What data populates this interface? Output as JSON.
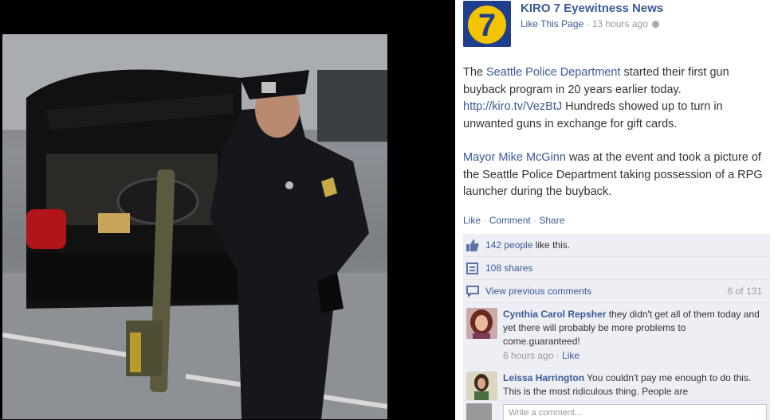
{
  "page": {
    "name": "KIRO 7 Eyewitness News",
    "like_page": "Like This Page",
    "separator": " · ",
    "time": "13 hours ago",
    "logo_numeral": "7"
  },
  "post": {
    "p1_link1": "Seattle Police Department",
    "p1_pre": "The ",
    "p1_mid": " started their first gun buyback program in 20 years earlier today. ",
    "p1_url": "http://kiro.tv/VezBtJ",
    "p1_post": " Hundreds showed up to turn in unwanted guns in exchange for gift cards.",
    "p2_link": "Mayor Mike McGinn",
    "p2_rest": " was at the event and took a picture of the Seattle Police Department taking possession of a RPG launcher during the buyback."
  },
  "actions": {
    "like": "Like",
    "comment": "Comment",
    "share": "Share",
    "sep": " · "
  },
  "ufi": {
    "likes_link": "142 people",
    "likes_text": " like this.",
    "shares": "108 shares",
    "view_previous": "View previous comments",
    "comment_count": "6 of 131"
  },
  "comments": [
    {
      "author": "Cynthia Carol Repsher",
      "text": " they didn't get all of them today and yet there will probably be more problems to come.guaranteed!",
      "time": "6 hours ago",
      "like": "Like"
    },
    {
      "author": "Leissa Harrington",
      "text": " You couldn't pay me enough to do this. This is the most ridiculous thing. People are"
    }
  ],
  "write_comment_placeholder": "Write a comment...",
  "colors": {
    "link": "#3b5998",
    "ufi_bg": "#edeff4",
    "logo_blue": "#1d3f8e",
    "logo_yellow": "#f5c400"
  },
  "icons": [
    "thumbs-up-icon",
    "share-icon",
    "comment-icon",
    "globe-icon"
  ]
}
